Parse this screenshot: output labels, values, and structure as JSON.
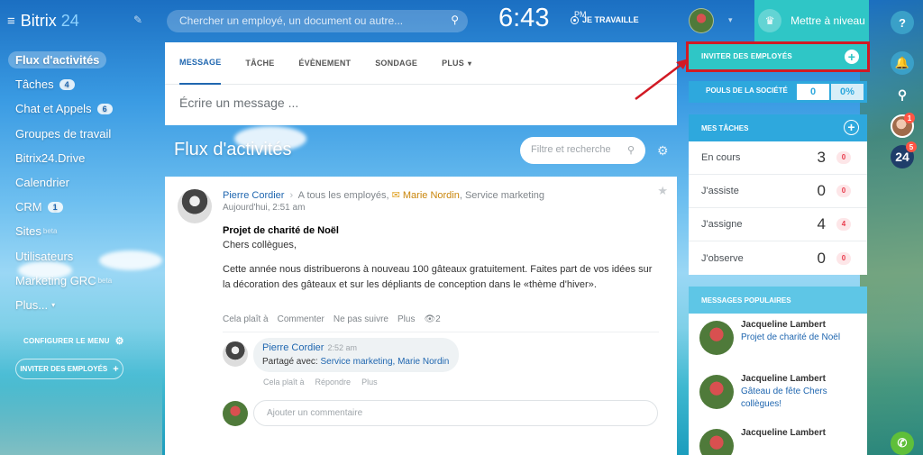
{
  "app": {
    "logo_main": "Bitrix",
    "logo_num": "24"
  },
  "sidebar": {
    "items": [
      {
        "label": "Flux d'activités",
        "count": ""
      },
      {
        "label": "Tâches",
        "count": "4"
      },
      {
        "label": "Chat et Appels",
        "count": "6"
      },
      {
        "label": "Groupes de travail",
        "count": ""
      },
      {
        "label": "Bitrix24.Drive",
        "count": ""
      },
      {
        "label": "Calendrier",
        "count": ""
      },
      {
        "label": "CRM",
        "count": "1"
      },
      {
        "label": "Sites",
        "count": "",
        "beta": "beta"
      },
      {
        "label": "Utilisateurs",
        "count": ""
      },
      {
        "label": "Marketing GRC",
        "count": "",
        "beta": "beta"
      },
      {
        "label": "Plus...",
        "count": ""
      }
    ],
    "configure_menu": "CONFIGURER LE MENU",
    "invite_button": "INVITER DES EMPLOYÉS"
  },
  "header": {
    "search_placeholder": "Chercher un employé, un document ou autre...",
    "time": "6:43",
    "ampm": "PM",
    "work_status": "JE TRAVAILLE",
    "upgrade_label": "Mettre à niveau"
  },
  "rail": {
    "help": "?",
    "b24_label": "24",
    "avatar_badge": "1",
    "b24_badge": "5"
  },
  "composer": {
    "tabs": [
      "MESSAGE",
      "TÂCHE",
      "ÉVÈNEMENT",
      "SONDAGE",
      "PLUS"
    ],
    "placeholder": "Écrire un message ..."
  },
  "feed": {
    "title": "Flux d'activités",
    "filter_placeholder": "Filtre et recherche"
  },
  "post": {
    "author": "Pierre Cordier",
    "recipients": "A tous les employés,",
    "target_person": "Marie Nordin",
    "target_group": ", Service marketing",
    "date": "Aujourd'hui, 2:51 am",
    "title": "Projet de charité de Noël",
    "greeting": "Chers collègues,",
    "body": "Cette année nous distribuerons à nouveau 100 gâteaux gratuitement. Faites part de vos idées sur la décoration des gâteaux et sur les dépliants de conception dans le «thème d'hiver».",
    "actions": {
      "like": "Cela plaît à",
      "comment": "Commenter",
      "unfollow": "Ne pas suivre",
      "more": "Plus",
      "views": "2"
    }
  },
  "comment": {
    "author": "Pierre Cordier",
    "time": "2:52 am",
    "shared_prefix": "Partagé avec: ",
    "shared_with": "Service marketing, Marie Nordin",
    "actions": {
      "like": "Cela plaît à",
      "reply": "Répondre",
      "more": "Plus"
    },
    "add_placeholder": "Ajouter un commentaire"
  },
  "right": {
    "invite": "INVITER DES EMPLOYÉS",
    "pulse": {
      "label": "POULS DE LA SOCIÉTÉ",
      "value": "0",
      "percent": "0%"
    },
    "tasks": {
      "title": "MES TÂCHES",
      "rows": [
        {
          "label": "En cours",
          "count": "3",
          "badge": "0"
        },
        {
          "label": "J'assiste",
          "count": "0",
          "badge": "0"
        },
        {
          "label": "J'assigne",
          "count": "4",
          "badge": "4"
        },
        {
          "label": "J'observe",
          "count": "0",
          "badge": "0"
        }
      ]
    },
    "popular": {
      "title": "MESSAGES POPULAIRES",
      "items": [
        {
          "name": "Jacqueline Lambert",
          "text": "Projet de charité de Noël"
        },
        {
          "name": "Jacqueline Lambert",
          "text": "Gâteau de fête Chers collègues!"
        },
        {
          "name": "Jacqueline Lambert",
          "text": ""
        }
      ]
    }
  },
  "colors": {
    "accent": "#2067b0",
    "teal": "#2fc6c6",
    "highlight": "#d11a24"
  }
}
